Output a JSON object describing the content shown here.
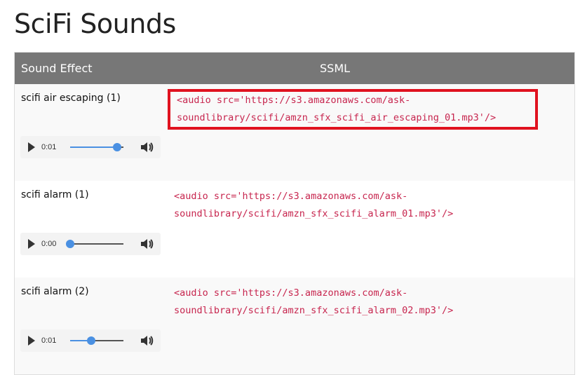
{
  "title": "SciFi Sounds",
  "headers": {
    "effect": "Sound Effect",
    "ssml": "SSML"
  },
  "rows": [
    {
      "name": "scifi air escaping (1)",
      "ssml_line1": "<audio src='https://s3.amazonaws.com/ask-",
      "ssml_line2": "soundlibrary/scifi/amzn_sfx_scifi_air_escaping_01.mp3'/>",
      "time": "0:01",
      "progress": 0.88,
      "highlighted": true
    },
    {
      "name": "scifi alarm (1)",
      "ssml_line1": "<audio src='https://s3.amazonaws.com/ask-",
      "ssml_line2": "soundlibrary/scifi/amzn_sfx_scifi_alarm_01.mp3'/>",
      "time": "0:00",
      "progress": 0.0,
      "highlighted": false
    },
    {
      "name": "scifi alarm (2)",
      "ssml_line1": "<audio src='https://s3.amazonaws.com/ask-",
      "ssml_line2": "soundlibrary/scifi/amzn_sfx_scifi_alarm_02.mp3'/>",
      "time": "0:01",
      "progress": 0.4,
      "highlighted": false
    }
  ],
  "colors": {
    "header_bg": "#777777",
    "code": "#c7254e",
    "highlight": "#e0121f",
    "slider": "#4a90e2"
  }
}
